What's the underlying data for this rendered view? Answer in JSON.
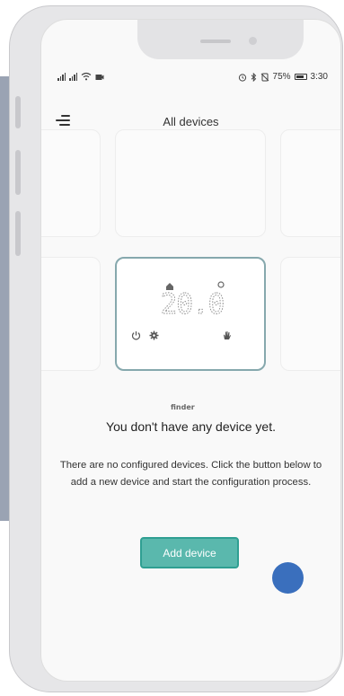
{
  "status_bar": {
    "battery_percent": "75%",
    "time": "3:30"
  },
  "header": {
    "title": "All devices"
  },
  "device_preview": {
    "temperature": "20.0",
    "brand": "finder"
  },
  "empty_state": {
    "title": "You don't have any device yet.",
    "description": "There are no configured devices. Click the button below to add a new device and start the configuration process."
  },
  "actions": {
    "add_device_label": "Add device"
  },
  "colors": {
    "accent": "#5ab8ad",
    "accent_border": "#2f9f92",
    "device_card_border": "#86a8ad",
    "tap_indicator": "#3a6fbd"
  },
  "icons": [
    "menu-icon",
    "home-icon",
    "power-icon",
    "gear-icon",
    "hand-icon",
    "cellular-signal-icon",
    "wifi-icon",
    "alarm-icon",
    "bluetooth-icon",
    "battery-icon"
  ]
}
